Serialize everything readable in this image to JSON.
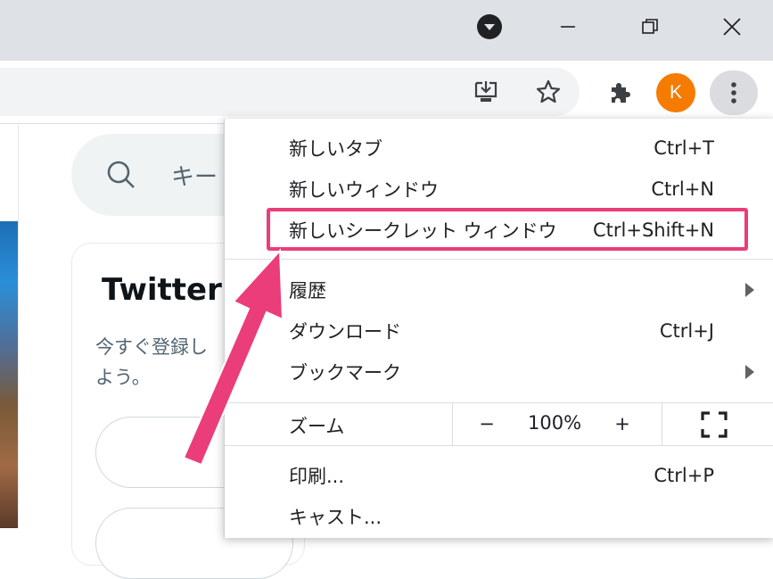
{
  "browser": {
    "profile_initial": "K",
    "profile_color": "#f57c00",
    "icons": [
      "tab-search-icon",
      "minimize-icon",
      "restore-icon",
      "close-icon",
      "install-app-icon",
      "bookmark-star-icon",
      "extensions-icon",
      "more-menu-icon"
    ]
  },
  "page": {
    "search_placeholder": "キー",
    "card_title": "Twitter",
    "card_text_line1": "今すぐ登録し",
    "card_text_line2": "よう。"
  },
  "menu": {
    "new_tab": {
      "label": "新しいタブ",
      "shortcut": "Ctrl+T"
    },
    "new_window": {
      "label": "新しいウィンドウ",
      "shortcut": "Ctrl+N"
    },
    "incognito": {
      "label": "新しいシークレット ウィンドウ",
      "shortcut": "Ctrl+Shift+N"
    },
    "history": {
      "label": "履歴"
    },
    "downloads": {
      "label": "ダウンロード",
      "shortcut": "Ctrl+J"
    },
    "bookmarks": {
      "label": "ブックマーク"
    },
    "zoom": {
      "label": "ズーム",
      "minus": "−",
      "value": "100%",
      "plus": "+"
    },
    "print": {
      "label": "印刷...",
      "shortcut": "Ctrl+P"
    },
    "cast": {
      "label": "キャスト..."
    }
  },
  "annotation": {
    "highlight_color": "#ea3d7a"
  }
}
